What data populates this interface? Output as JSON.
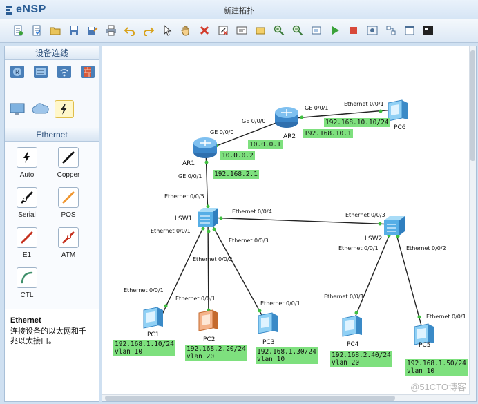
{
  "app": {
    "name": "eNSP",
    "window_title": "新建拓扑"
  },
  "toolbar": {
    "buttons": [
      "new-topology",
      "new-example",
      "open",
      "save",
      "save-as",
      "print",
      "undo",
      "redo",
      "select",
      "drag",
      "delete",
      "delete-all-links",
      "text",
      "rectangle",
      "zoom-in",
      "zoom-out",
      "restore",
      "start-device",
      "stop-device",
      "capture",
      "show-interface",
      "palette",
      "terminal"
    ]
  },
  "left_panel": {
    "header": "设备连线",
    "devices": [
      "router",
      "switch",
      "wireless",
      "firewall",
      "pc",
      "cloud",
      "cable"
    ],
    "sub_header": "Ethernet",
    "cables": [
      {
        "label": "Auto",
        "color": "#111111"
      },
      {
        "label": "Copper",
        "color": "#111111"
      },
      {
        "label": "Serial",
        "color": "#111111"
      },
      {
        "label": "POS",
        "color": "#f0962f"
      },
      {
        "label": "E1",
        "color": "#c5301d"
      },
      {
        "label": "ATM",
        "color": "#c5301d"
      },
      {
        "label": "CTL",
        "color": "#3f8f6a"
      }
    ],
    "info": {
      "title": "Ethernet",
      "desc": "连接设备的以太网和千兆以太接口。"
    }
  },
  "topology": {
    "nodes": {
      "ar1": "AR1",
      "ar2": "AR2",
      "lsw1": "LSW1",
      "lsw2": "LSW2",
      "pc1": "PC1",
      "pc2": "PC2",
      "pc3": "PC3",
      "pc4": "PC4",
      "pc5": "PC5",
      "pc6": "PC6"
    },
    "ports": {
      "ar1_ge000": "GE 0/0/0",
      "ar1_ge001": "GE 0/0/1",
      "ar2_ge000": "GE 0/0/0",
      "ar2_ge001": "GE 0/0/1",
      "pc6_eth": "Ethernet 0/0/1",
      "lsw1_005": "Ethernet 0/0/5",
      "lsw1_004": "Ethernet 0/0/4",
      "lsw1_001": "Ethernet 0/0/1",
      "lsw1_002": "Ethernet 0/0/2",
      "lsw1_003": "Ethernet 0/0/3",
      "lsw2_003": "Ethernet 0/0/3",
      "lsw2_001": "Ethernet 0/0/1",
      "lsw2_002": "Ethernet 0/0/2",
      "pc1_eth": "Ethernet 0/0/1",
      "pc2_eth": "Ethernet 0/0/1",
      "pc3_eth": "Ethernet 0/0/1",
      "pc4_eth": "Ethernet 0/0/1",
      "pc5_eth": "Ethernet 0/0/1"
    },
    "labels": {
      "ar2_pc6_net": "192.168.10.10/24",
      "ar2_pc6_gw": "192.168.10.1",
      "ar2_ip": "10.0.0.1",
      "ar1_ip": "10.0.0.2",
      "ar1_lan": "192.168.2.1",
      "pc1": "192.168.1.10/24\nvlan 10",
      "pc2": "192.168.2.20/24\nvlan 20",
      "pc3": "192.168.1.30/24\nvlan 10",
      "pc4": "192.168.2.40/24\nvlan 20",
      "pc5": "192.168.1.50/24\nvlan 10"
    }
  },
  "watermark": "@51CTO博客"
}
